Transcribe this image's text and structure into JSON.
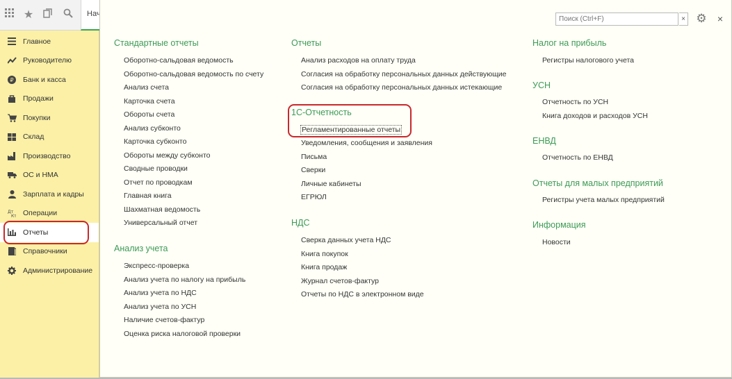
{
  "toolbar": {
    "icons": [
      "apps-grid-icon",
      "star-icon",
      "history-icon",
      "search-icon"
    ],
    "tab_label": "Нач"
  },
  "sidebar": {
    "items": [
      {
        "label": "Главное",
        "icon": "menu-icon"
      },
      {
        "label": "Руководителю",
        "icon": "trend-icon"
      },
      {
        "label": "Банк и касса",
        "icon": "ruble-icon"
      },
      {
        "label": "Продажи",
        "icon": "bag-icon"
      },
      {
        "label": "Покупки",
        "icon": "cart-icon"
      },
      {
        "label": "Склад",
        "icon": "warehouse-icon"
      },
      {
        "label": "Производство",
        "icon": "factory-icon"
      },
      {
        "label": "ОС и НМА",
        "icon": "truck-icon"
      },
      {
        "label": "Зарплата и кадры",
        "icon": "person-icon"
      },
      {
        "label": "Операции",
        "icon": "dtkt-icon"
      },
      {
        "label": "Отчеты",
        "icon": "bar-chart-icon",
        "active": true
      },
      {
        "label": "Справочники",
        "icon": "book-icon"
      },
      {
        "label": "Администрирование",
        "icon": "gear-icon"
      }
    ]
  },
  "search": {
    "placeholder": "Поиск (Ctrl+F)",
    "clear": "×"
  },
  "close_label": "×",
  "columns": {
    "col1": {
      "standard": {
        "title": "Стандартные отчеты",
        "links": [
          "Оборотно-сальдовая ведомость",
          "Оборотно-сальдовая ведомость по счету",
          "Анализ счета",
          "Карточка счета",
          "Обороты счета",
          "Анализ субконто",
          "Карточка субконто",
          "Обороты между субконто",
          "Сводные проводки",
          "Отчет по проводкам",
          "Главная книга",
          "Шахматная ведомость",
          "Универсальный отчет"
        ]
      },
      "analysis": {
        "title": "Анализ учета",
        "links": [
          "Экспресс-проверка",
          "Анализ учета по налогу на прибыль",
          "Анализ учета по НДС",
          "Анализ учета по УСН",
          "Наличие счетов-фактур",
          "Оценка риска налоговой проверки"
        ]
      }
    },
    "col2": {
      "reports": {
        "title": "Отчеты",
        "links": [
          "Анализ расходов на оплату труда",
          "Согласия на обработку персональных данных действующие",
          "Согласия на обработку персональных данных истекающие"
        ]
      },
      "reporting_1c": {
        "title": "1С-Отчетность",
        "links": [
          "Регламентированные отчеты",
          "Уведомления, сообщения и заявления",
          "Письма",
          "Сверки",
          "Личные кабинеты",
          "ЕГРЮЛ"
        ]
      },
      "vat": {
        "title": "НДС",
        "links": [
          "Сверка данных учета НДС",
          "Книга покупок",
          "Книга продаж",
          "Журнал счетов-фактур",
          "Отчеты по НДС в электронном виде"
        ]
      }
    },
    "col3": {
      "profit_tax": {
        "title": "Налог на прибыль",
        "links": [
          "Регистры налогового учета"
        ]
      },
      "usn": {
        "title": "УСН",
        "links": [
          "Отчетность по УСН",
          "Книга доходов и расходов УСН"
        ]
      },
      "envd": {
        "title": "ЕНВД",
        "links": [
          "Отчетность по ЕНВД"
        ]
      },
      "small_biz": {
        "title": "Отчеты для малых предприятий",
        "links": [
          "Регистры учета малых предприятий"
        ]
      },
      "info": {
        "title": "Информация",
        "links": [
          "Новости"
        ]
      }
    }
  },
  "colors": {
    "accent_green": "#3c9a57",
    "sidebar_bg": "#fbf0a6",
    "highlight_red": "#c8282c"
  }
}
